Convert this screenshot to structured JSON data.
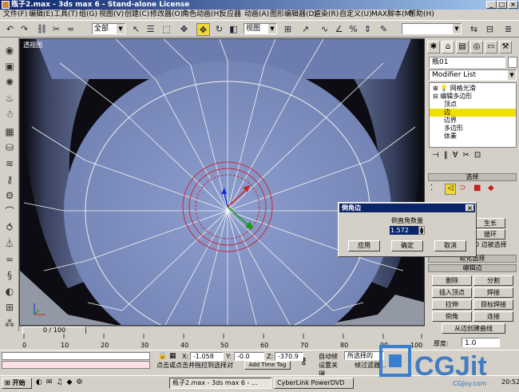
{
  "window": {
    "title": "瓶子2.max - 3ds max 6 - Stand-alone License",
    "min": "_",
    "max": "□",
    "close": "×"
  },
  "menu": [
    "文件(F)",
    "编辑(E)",
    "工具(T)",
    "组(G)",
    "视图(V)",
    "创建(C)",
    "修改器(O)",
    "角色动画(H)",
    "反应器",
    "动画(A)",
    "图形编辑器(D)",
    "渲染(R)",
    "自定义(U)",
    "MAX脚本(M)",
    "帮助(H)"
  ],
  "toolbar": {
    "selection_filter": "全部",
    "view_coord": "视图"
  },
  "viewport": {
    "label": "透视图"
  },
  "right_panel": {
    "object_name": "瓶01",
    "modifier_list": "Modifier List",
    "modifiers": [
      {
        "label": "网格光滑",
        "indent": 0,
        "expand": "⊞",
        "selected": false
      },
      {
        "label": "编辑多边形",
        "indent": 0,
        "expand": "⊟",
        "selected": false
      },
      {
        "label": "顶点",
        "indent": 1,
        "expand": "",
        "selected": false
      },
      {
        "label": "边",
        "indent": 1,
        "expand": "",
        "selected": true
      },
      {
        "label": "边界",
        "indent": 1,
        "expand": "",
        "selected": false
      },
      {
        "label": "多边形",
        "indent": 1,
        "expand": "",
        "selected": false
      },
      {
        "label": "体素",
        "indent": 1,
        "expand": "",
        "selected": false
      }
    ],
    "rollout_select": "选择",
    "grow": "生长",
    "ring": "循环",
    "edge_select": "0 边被选择",
    "rollout_soft": "软化选择",
    "rollout_edit": "编辑边",
    "remove": "删除",
    "split": "分割",
    "insert_vertex": "插入顶点",
    "weld": "焊接",
    "extrude": "拉伸",
    "target_weld": "目标焊接",
    "chamfer": "倒角",
    "connect": "连接",
    "create_shape": "从边创建曲线",
    "thickness_label": "厚度:",
    "thickness_value": "1.0"
  },
  "dialog": {
    "title": "倒角边",
    "label": "倒直角数量",
    "value": "1.572",
    "apply": "应用",
    "ok": "确定",
    "cancel": "取消",
    "close": "×"
  },
  "timeline": {
    "frame": "0 / 100",
    "ticks": [
      "0",
      "10",
      "20",
      "30",
      "40",
      "50",
      "60",
      "70",
      "80",
      "90",
      "100"
    ]
  },
  "status": {
    "x_label": "X:",
    "x": "-1.058",
    "y_label": "Y:",
    "y": "-0.0",
    "z_label": "Z:",
    "z": "-370.9",
    "auto_key": "自动帧",
    "set_key": "设置关键",
    "selected": "所选择的",
    "key_filters": "帧过滤器...",
    "prompt": "点击或点击并拖拉到选择对",
    "add_time_tag": "Add Time Tag"
  },
  "taskbar": {
    "start": "开始",
    "tasks": [
      "瓶子2.max - 3ds max 6 - ...",
      "CyberLink PowerDVD"
    ],
    "clock": "20:52"
  },
  "logo": {
    "text": "CGJoy.com"
  }
}
